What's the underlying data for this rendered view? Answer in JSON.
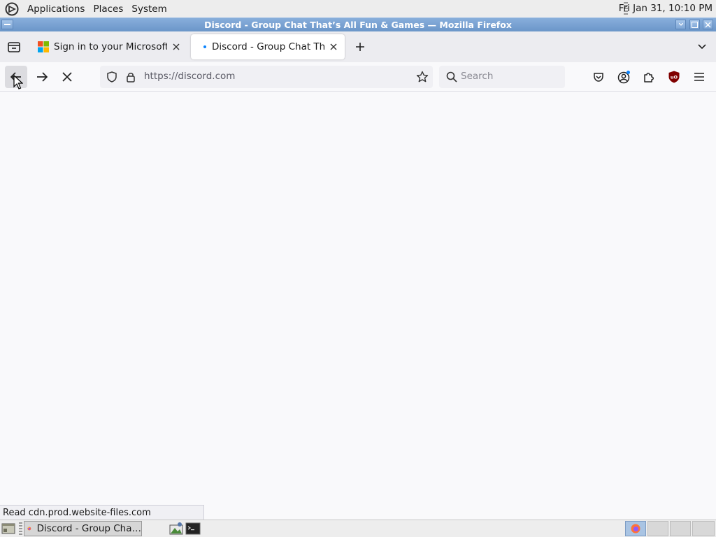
{
  "top_panel": {
    "menus": [
      "Applications",
      "Places",
      "System"
    ],
    "clock": "Fri Jan 31, 10:10 PM"
  },
  "window": {
    "title": "Discord - Group Chat That’s All Fun & Games — Mozilla Firefox"
  },
  "tabs": [
    {
      "label": "Sign in to your Microsoft account",
      "icon": "microsoft-logo-icon",
      "active": false
    },
    {
      "label": "Discord - Group Chat That’s All Fun & Games",
      "icon": "loading-dot-icon",
      "active": true
    }
  ],
  "navbar": {
    "url": "https://discord.com",
    "search_placeholder": "Search"
  },
  "status": {
    "text": "Read cdn.prod.website-files.com"
  },
  "taskbar": {
    "task_label": "Discord - Group Cha…"
  },
  "colors": {
    "titlebar": "#6b96c9",
    "accent": "#0a84ff",
    "ublock": "#800000"
  }
}
